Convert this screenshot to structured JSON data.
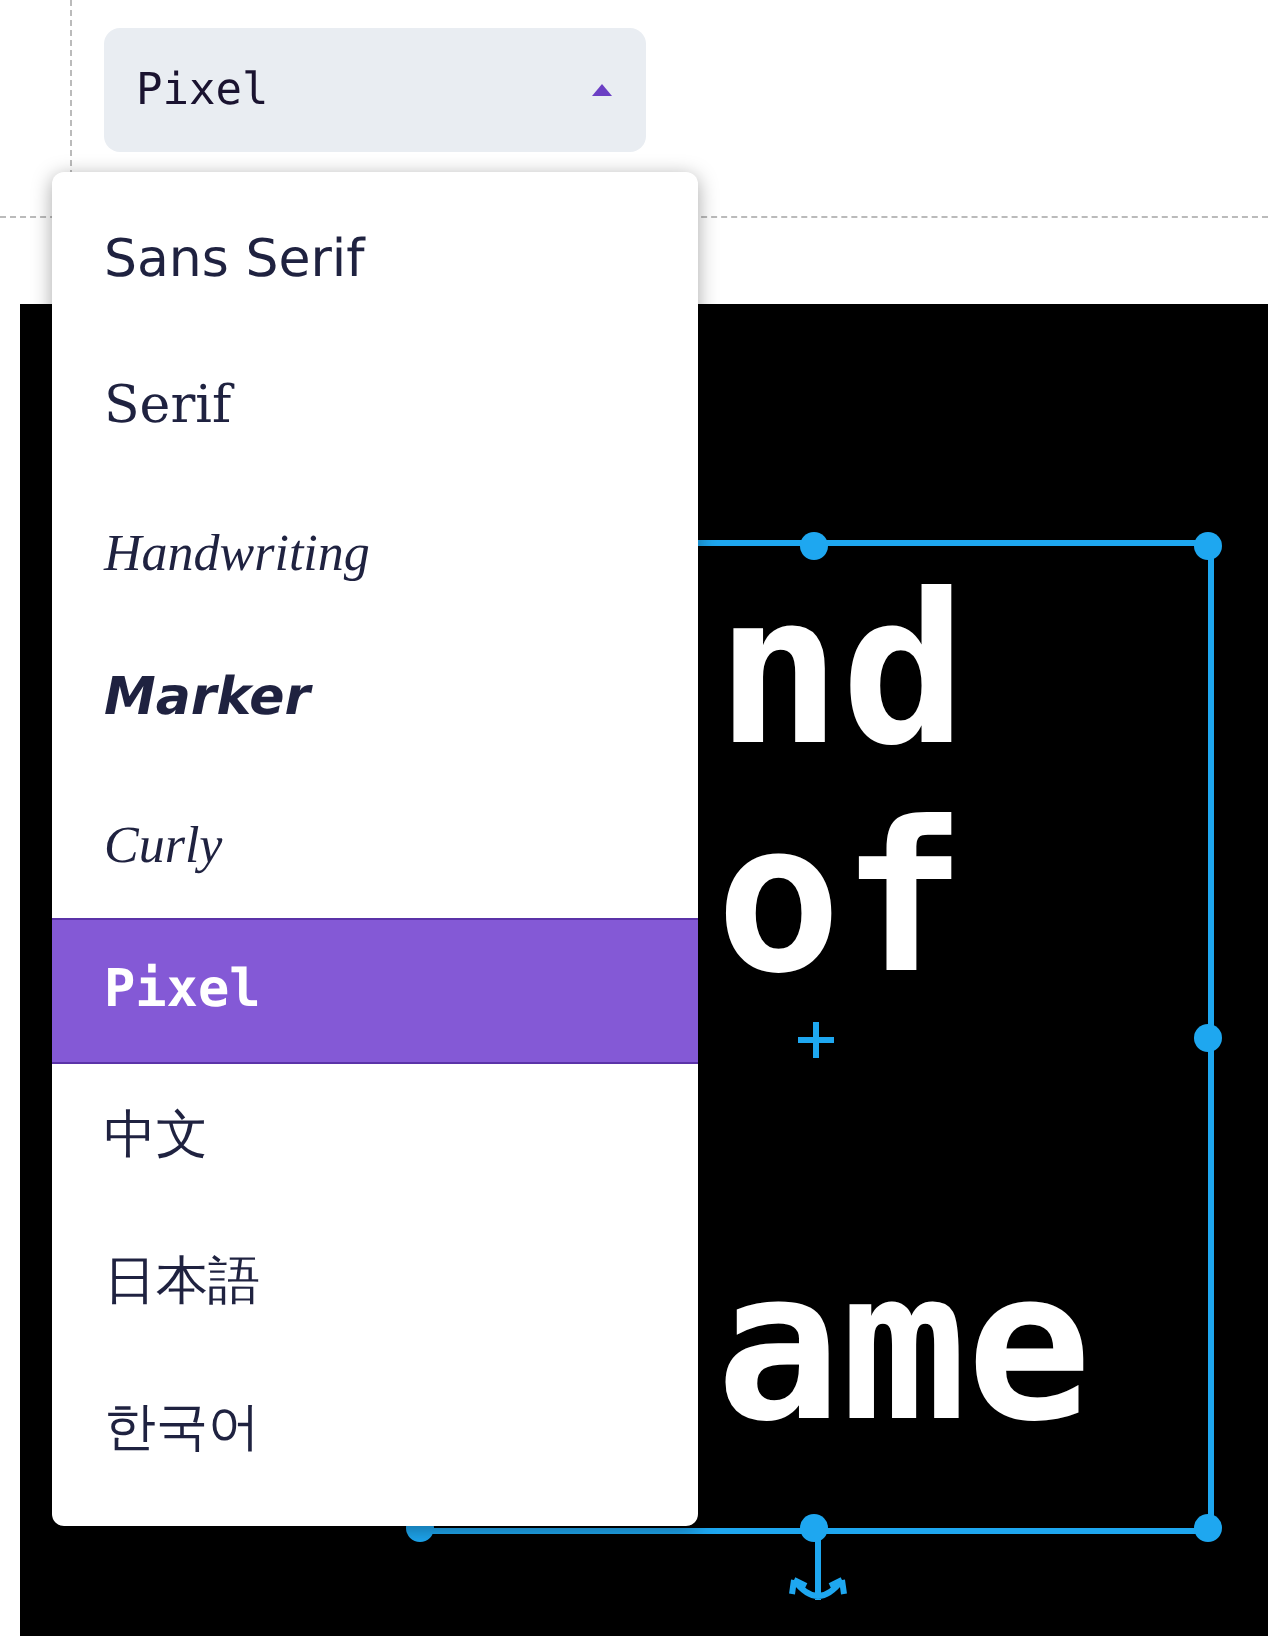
{
  "font_dropdown": {
    "value": "Pixel",
    "expanded": true
  },
  "font_menu": [
    {
      "label": "Sans Serif",
      "kind": "sans",
      "selected": false
    },
    {
      "label": "Serif",
      "kind": "serif",
      "selected": false
    },
    {
      "label": "Handwriting",
      "kind": "handwriting",
      "selected": false
    },
    {
      "label": "Marker",
      "kind": "marker",
      "selected": false
    },
    {
      "label": "Curly",
      "kind": "curly",
      "selected": false
    },
    {
      "label": "Pixel",
      "kind": "pixel",
      "selected": true
    },
    {
      "label": "中文",
      "kind": "cjk",
      "selected": false
    },
    {
      "label": "日本語",
      "kind": "cjk",
      "selected": false
    },
    {
      "label": "한국어",
      "kind": "cjk",
      "selected": false
    }
  ],
  "canvas_text": {
    "lines": [
      "nd",
      "of",
      "ame"
    ]
  }
}
